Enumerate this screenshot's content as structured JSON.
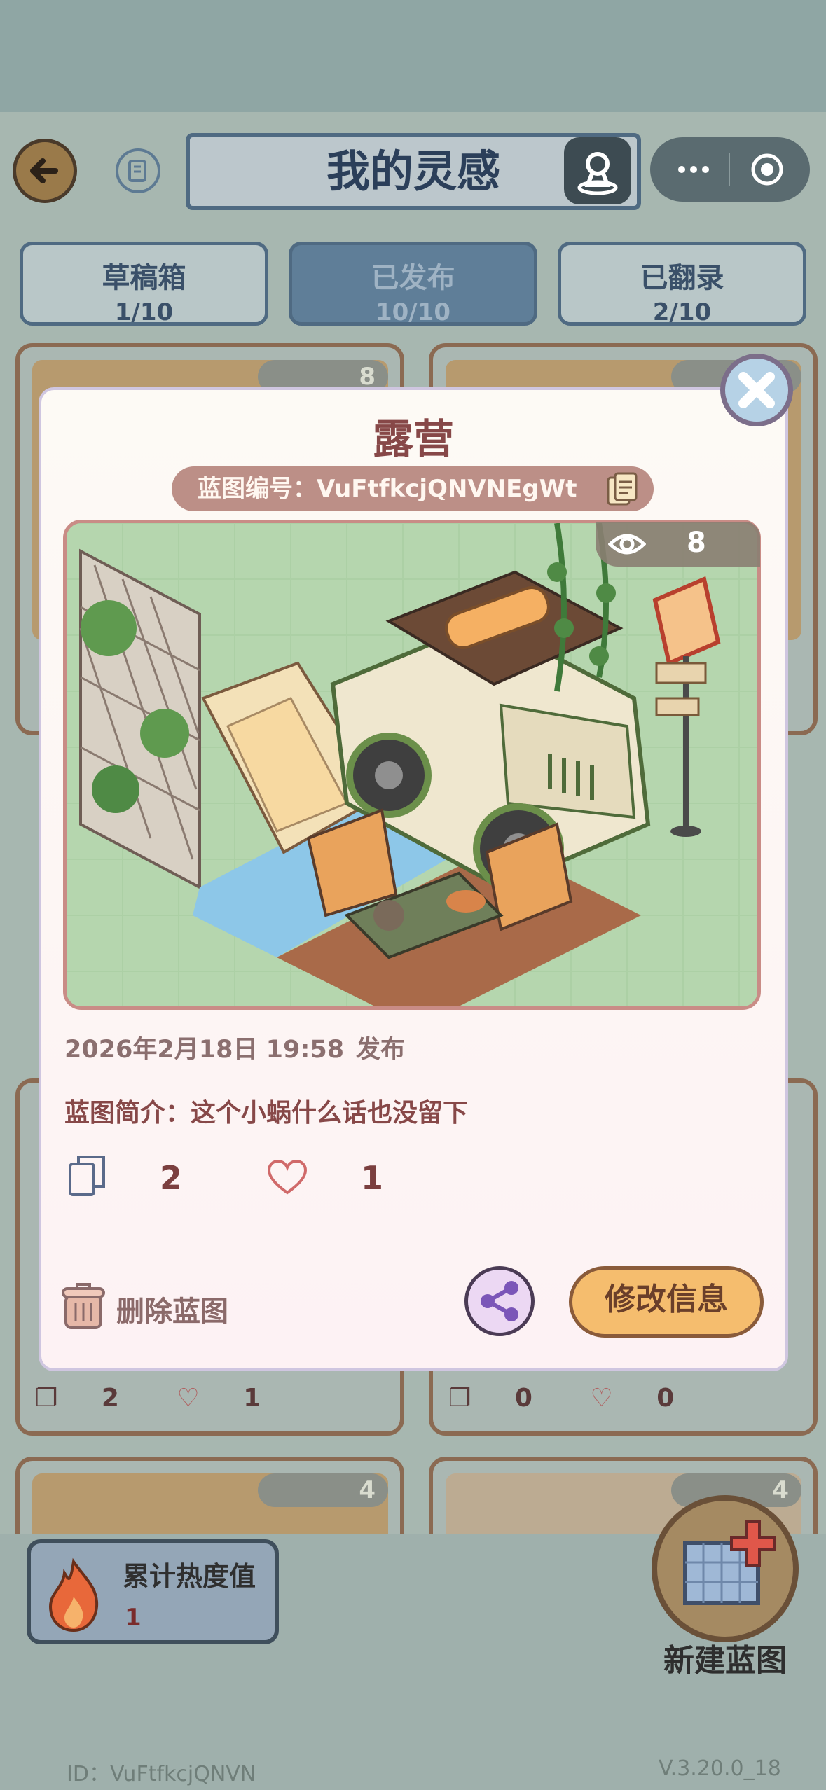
{
  "header": {
    "title": "我的灵感"
  },
  "tabs": [
    {
      "label": "草稿箱",
      "count": "1/10",
      "active": false
    },
    {
      "label": "已发布",
      "count": "10/10",
      "active": true
    },
    {
      "label": "已翻录",
      "count": "2/10",
      "active": false
    }
  ],
  "background_cards": {
    "card1_views": "8",
    "card2_views": "",
    "row2_left": {
      "copies": "2",
      "likes": "1"
    },
    "row2_right": {
      "copies": "0",
      "likes": "0"
    },
    "card5_views": "4",
    "card6_views": "4"
  },
  "modal": {
    "title": "露营",
    "blueprint_id_label": "蓝图编号：VuFtfkcjQNVNEgWt",
    "views": "8",
    "date": "2026年2月18日 19:58",
    "status": "发布",
    "intro": "蓝图简介：这个小蜗什么话也没留下",
    "copies": "2",
    "likes": "1",
    "delete_label": "删除蓝图",
    "edit_label": "修改信息"
  },
  "heat": {
    "label": "累计热度值",
    "value": "1"
  },
  "new_blueprint": {
    "label": "新建蓝图"
  },
  "footer": {
    "id": "ID：VuFtfkcjQNVN",
    "version": "V.3.20.0_18"
  },
  "icons": [
    "back-arrow-icon",
    "guide-book-icon",
    "avatar-icon",
    "more-icon",
    "record-icon",
    "eye-icon",
    "copy-icon",
    "heart-icon",
    "trash-icon",
    "share-icon",
    "close-icon",
    "flame-icon",
    "blueprint-add-icon"
  ],
  "colors": {
    "accent": "#f5bd6e",
    "title": "#874848",
    "overlay": "#a7b7b0"
  }
}
